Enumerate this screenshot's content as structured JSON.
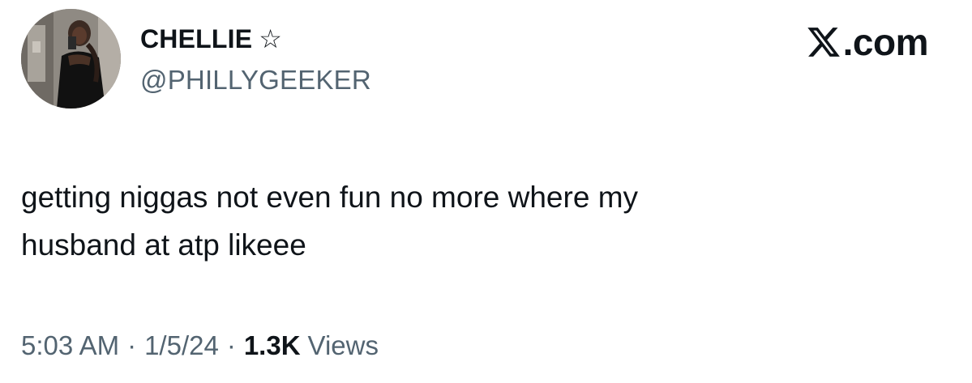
{
  "author": {
    "display_name": "CHELLIE",
    "badge_icon": "star-outline-icon",
    "handle": "@PHILLYGEEKER",
    "avatar": "profile-photo"
  },
  "brand": {
    "icon": "x-logo-icon",
    "label": ".com"
  },
  "tweet": {
    "line1": "getting niggas not even fun no more where my",
    "line2": "husband at atp likeee"
  },
  "meta": {
    "time": "5:03 AM",
    "separator": "·",
    "date": "1/5/24",
    "views_count": "1.3K",
    "views_label": "Views"
  },
  "colors": {
    "text_primary": "#0f1419",
    "text_secondary": "#536471",
    "background": "#ffffff"
  }
}
